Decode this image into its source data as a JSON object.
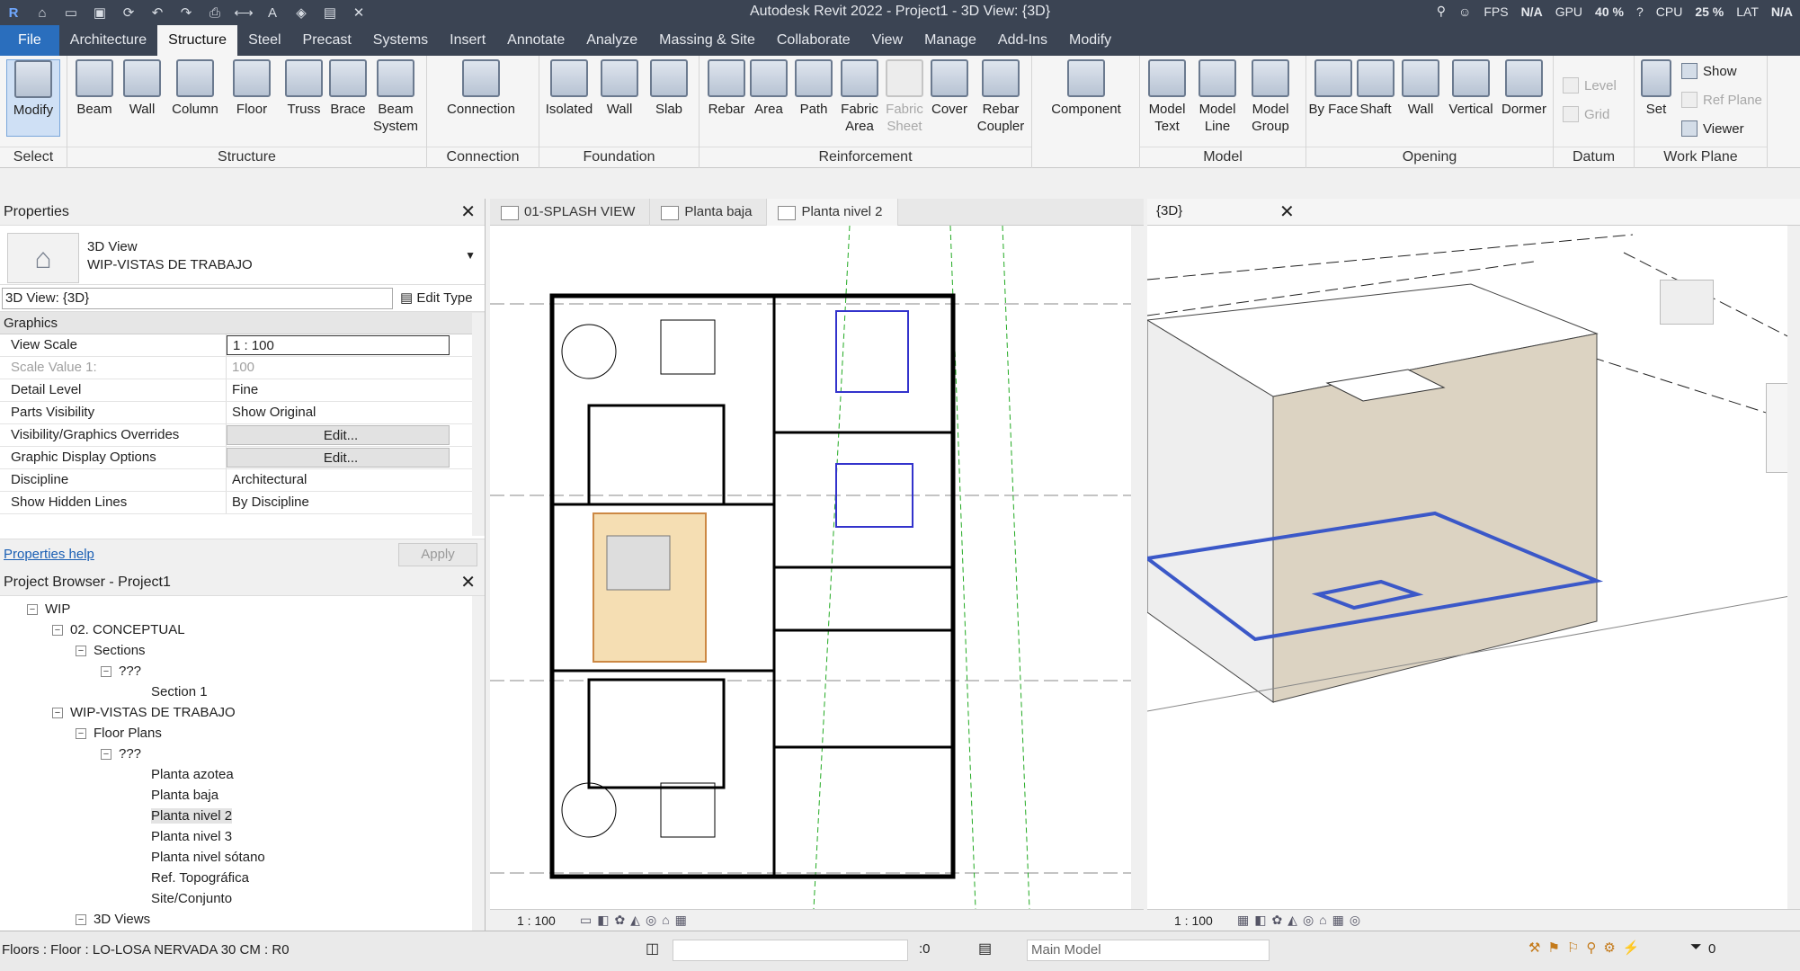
{
  "app": {
    "title": "Autodesk Revit 2022 - Project1 - 3D View: {3D}"
  },
  "stats": {
    "fps_label": "FPS",
    "fps": "N/A",
    "gpu_label": "GPU",
    "gpu": "40 %",
    "cpu_label": "CPU",
    "cpu": "25 %",
    "lat_label": "LAT",
    "lat": "N/A"
  },
  "tabs": [
    "File",
    "Architecture",
    "Structure",
    "Steel",
    "Precast",
    "Systems",
    "Insert",
    "Annotate",
    "Analyze",
    "Massing & Site",
    "Collaborate",
    "View",
    "Manage",
    "Add-Ins",
    "Modify"
  ],
  "ribbon": {
    "select": {
      "modify": "Modify",
      "title": "Select"
    },
    "structure": {
      "beam": "Beam",
      "wall": "Wall",
      "column": "Column",
      "floor": "Floor",
      "truss": "Truss",
      "brace": "Brace",
      "beam_system": "Beam System",
      "title": "Structure"
    },
    "connection": {
      "connection": "Connection",
      "title": "Connection"
    },
    "foundation": {
      "isolated": "Isolated",
      "wall": "Wall",
      "slab": "Slab",
      "title": "Foundation"
    },
    "reinforcement": {
      "rebar": "Rebar",
      "area": "Area",
      "path": "Path",
      "fabric_area": "Fabric Area",
      "fabric_sheet": "Fabric Sheet",
      "cover": "Cover",
      "rebar_coupler": "Rebar Coupler",
      "title": "Reinforcement"
    },
    "component": {
      "component": "Component"
    },
    "model": {
      "model_text": "Model Text",
      "model_line": "Model Line",
      "model_group": "Model Group",
      "title": "Model"
    },
    "opening": {
      "by_face": "By Face",
      "shaft": "Shaft",
      "wall": "Wall",
      "vertical": "Vertical",
      "dormer": "Dormer",
      "title": "Opening"
    },
    "datum": {
      "level": "Level",
      "grid": "Grid",
      "title": "Datum"
    },
    "work_plane": {
      "set": "Set",
      "show": "Show",
      "ref_plane": "Ref Plane",
      "viewer": "Viewer",
      "title": "Work Plane"
    }
  },
  "properties": {
    "title": "Properties",
    "type_line1": "3D View",
    "type_line2": "WIP-VISTAS DE TRABAJO",
    "instance": "3D View: {3D}",
    "edit_type": "Edit Type",
    "group": "Graphics",
    "rows": [
      {
        "k": "View Scale",
        "v": "1 : 100"
      },
      {
        "k": "Scale Value    1:",
        "v": "100"
      },
      {
        "k": "Detail Level",
        "v": "Fine"
      },
      {
        "k": "Parts Visibility",
        "v": "Show Original"
      },
      {
        "k": "Visibility/Graphics Overrides",
        "v": "Edit..."
      },
      {
        "k": "Graphic Display Options",
        "v": "Edit..."
      },
      {
        "k": "Discipline",
        "v": "Architectural"
      },
      {
        "k": "Show Hidden Lines",
        "v": "By Discipline"
      }
    ],
    "help": "Properties help",
    "apply": "Apply"
  },
  "browser": {
    "title": "Project Browser - Project1",
    "nodes": [
      {
        "label": "WIP",
        "lvl": 0,
        "box": "−"
      },
      {
        "label": "02. CONCEPTUAL",
        "lvl": 1,
        "box": "−"
      },
      {
        "label": "Sections",
        "lvl": 2,
        "box": "−"
      },
      {
        "label": "???",
        "lvl": 3,
        "box": "−"
      },
      {
        "label": "Section 1",
        "lvl": 4,
        "box": ""
      },
      {
        "label": "WIP-VISTAS DE TRABAJO",
        "lvl": 1,
        "box": "−"
      },
      {
        "label": "Floor Plans",
        "lvl": 2,
        "box": "−"
      },
      {
        "label": "???",
        "lvl": 3,
        "box": "−"
      },
      {
        "label": "Planta azotea",
        "lvl": 4,
        "box": ""
      },
      {
        "label": "Planta baja",
        "lvl": 4,
        "box": ""
      },
      {
        "label": "Planta nivel 2",
        "lvl": 4,
        "box": "",
        "sel": true
      },
      {
        "label": "Planta nivel 3",
        "lvl": 4,
        "box": ""
      },
      {
        "label": "Planta nivel sótano",
        "lvl": 4,
        "box": ""
      },
      {
        "label": "Ref. Topográfica",
        "lvl": 4,
        "box": ""
      },
      {
        "label": "Site/Conjunto",
        "lvl": 4,
        "box": ""
      },
      {
        "label": "3D Views",
        "lvl": 2,
        "box": "−"
      },
      {
        "label": "???",
        "lvl": 3,
        "box": "−"
      }
    ]
  },
  "views": {
    "tabs": [
      "01-SPLASH VIEW",
      "Planta baja",
      "Planta nivel 2"
    ],
    "tab3d": "{3D}",
    "scale2d": "1 : 100",
    "scale3d": "1 : 100"
  },
  "status": {
    "message": "Floors : Floor : LO-LOSA NERVADA 30 CM : R0",
    "model": "Main Model",
    "sel_count": ":0",
    "filter_count": "0"
  }
}
